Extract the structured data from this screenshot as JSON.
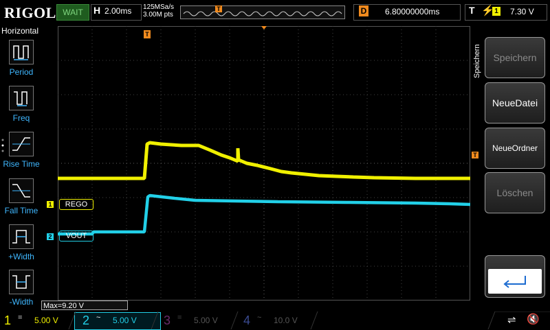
{
  "topbar": {
    "logo": "RIGOL",
    "run_state": "WAIT",
    "horizontal_label": "H",
    "horizontal_value": "2.00ms",
    "sample_rate": "125MSa/s",
    "memory_depth": "3.00M pts",
    "trigger_marker": "T",
    "delay_label": "D",
    "delay_value": "6.80000000ms",
    "trigger_label": "T",
    "trigger_edge": "⚡",
    "trigger_channel": "1",
    "trigger_level": "7.30 V"
  },
  "left_menu": {
    "title": "Horizontal",
    "items": [
      {
        "label": "Period"
      },
      {
        "label": "Freq"
      },
      {
        "label": "Rise Time"
      },
      {
        "label": "Fall Time"
      },
      {
        "label": "+Width"
      },
      {
        "label": "-Width"
      }
    ]
  },
  "right_menu": {
    "title": "Speichern",
    "buttons": [
      {
        "label": "Speichern",
        "enabled": false
      },
      {
        "label": "NeueDatei",
        "enabled": true
      },
      {
        "label": "NeueOrdner",
        "enabled": true
      },
      {
        "label": "Löschen",
        "enabled": false
      }
    ]
  },
  "traces": {
    "ch1_label": "REGO",
    "ch1_marker": "1",
    "ch2_label": "VOUT",
    "ch2_marker": "2",
    "trigger_level_marker": "T",
    "trigger_top_marker": "T"
  },
  "measurement": "Max=9.20 V",
  "channels": [
    {
      "num": "1",
      "coupling": "=",
      "scale": "5.00 V",
      "color": "#f0f000"
    },
    {
      "num": "2",
      "coupling": "~",
      "scale": "5.00 V",
      "color": "#22d0e8"
    },
    {
      "num": "3",
      "coupling": "=",
      "scale": "5.00 V",
      "color": "#c040c0"
    },
    {
      "num": "4",
      "coupling": "~",
      "scale": "10.0 V",
      "color": "#4a60c8"
    }
  ],
  "colors": {
    "ch1": "#f0f000",
    "ch2": "#22d0e8",
    "trigger": "#f08a1e",
    "menu_label": "#3fb7ff"
  },
  "icons": {
    "usb": "usb-icon",
    "mute": "speaker-mute-icon"
  }
}
